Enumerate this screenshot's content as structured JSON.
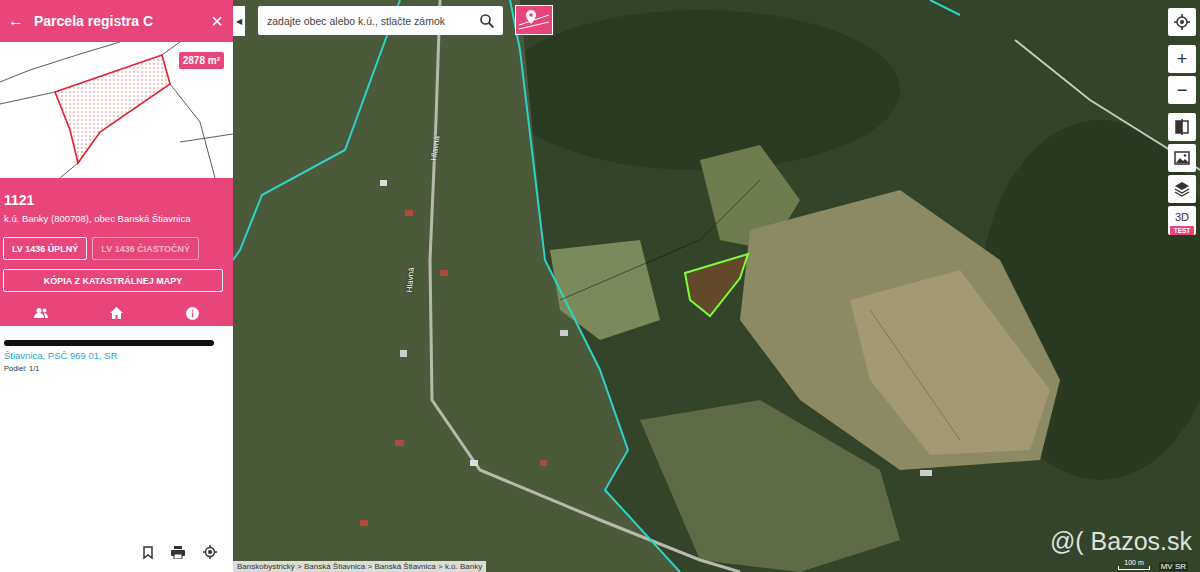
{
  "panel": {
    "title": "Parcela registra C",
    "back_icon": "←",
    "close_icon": "×",
    "thumbnail": {
      "area_badge": "2878 m²"
    },
    "parcel": {
      "number": "1121",
      "location": "k.ú. Banky (800708), obec Banská Štiavnica"
    },
    "buttons": [
      {
        "label": "LV 1436 ÚPLNÝ",
        "disabled": false
      },
      {
        "label": "LV 1436 ČIASTOČNÝ",
        "disabled": true
      },
      {
        "label": "KÓPIA Z KATASTRÁLNEJ MAPY",
        "disabled": false
      }
    ],
    "tabs": [
      {
        "kind": "owners"
      },
      {
        "kind": "property"
      },
      {
        "kind": "info"
      }
    ],
    "owner": {
      "address": "Štiavnica, PSČ 969 01, SR",
      "share": "Podiel: 1/1"
    },
    "footer_actions": [
      {
        "kind": "bookmark"
      },
      {
        "kind": "print"
      },
      {
        "kind": "locate"
      }
    ]
  },
  "collapse_icon": "◀",
  "map": {
    "search": {
      "placeholder": "zadajte obec alebo k.ú., stlačte zámok"
    },
    "controls": [
      {
        "kind": "locate"
      },
      {
        "kind": "zoom-in",
        "label": "+"
      },
      {
        "kind": "zoom-out",
        "label": "−"
      },
      {
        "kind": "compare"
      },
      {
        "kind": "image"
      },
      {
        "kind": "layers"
      },
      {
        "kind": "3d",
        "label": "3D",
        "badge": "TEST"
      }
    ],
    "road_labels": [
      "Hlavná",
      "Hlavná"
    ],
    "breadcrumb": "Banskobystrický > Banská Štiavnica > Banská Štiavnica > k.ú. Banky",
    "scale": "100 m",
    "attribution": "MV SR",
    "watermark": "@( Bazos.sk"
  }
}
